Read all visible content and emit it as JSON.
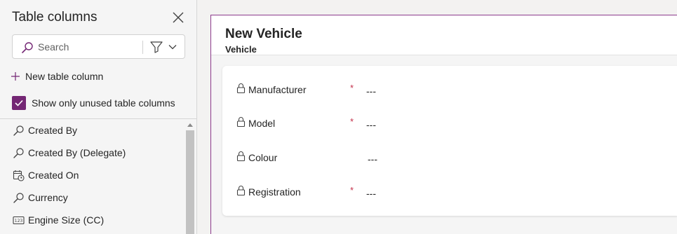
{
  "panel": {
    "title": "Table columns",
    "search_placeholder": "Search",
    "new_column_label": "New table column",
    "show_unused_label": "Show only unused table columns",
    "show_unused_checked": true,
    "columns": [
      {
        "label": "Created By",
        "icon": "lookup-icon"
      },
      {
        "label": "Created By (Delegate)",
        "icon": "lookup-icon"
      },
      {
        "label": "Created On",
        "icon": "calendar-clock-icon"
      },
      {
        "label": "Currency",
        "icon": "lookup-icon"
      },
      {
        "label": "Engine Size (CC)",
        "icon": "number-icon"
      }
    ]
  },
  "form": {
    "title": "New Vehicle",
    "subtitle": "Vehicle",
    "fields": [
      {
        "label": "Manufacturer",
        "required": "*",
        "value": "---"
      },
      {
        "label": "Model",
        "required": "*",
        "value": "---"
      },
      {
        "label": "Colour",
        "required": "",
        "value": "---"
      },
      {
        "label": "Registration",
        "required": "*",
        "value": "---"
      }
    ]
  },
  "colors": {
    "accent": "#742774",
    "canvas_border": "#8c3a8c",
    "required": "#c4314b"
  }
}
